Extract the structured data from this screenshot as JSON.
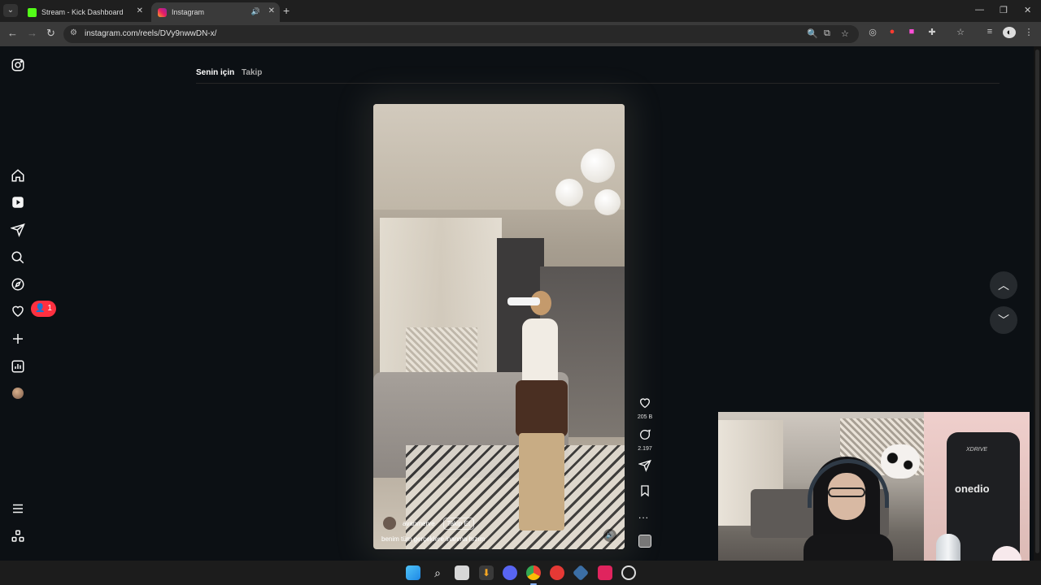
{
  "browser": {
    "tabs": [
      {
        "title": "Stream - Kick Dashboard"
      },
      {
        "title": "Instagram"
      }
    ],
    "url": "instagram.com/reels/DVy9nwwDN-x/"
  },
  "feed": {
    "tab_active": "Senin için",
    "tab_inactive": "Takip"
  },
  "notifications": {
    "badge_count": "1"
  },
  "reel": {
    "username": "avanmerve",
    "follow_label": "Takip Et",
    "caption": "benim tüm gerçeklere inanma hızım",
    "likes": "205 B",
    "comments": "2.197",
    "more": "..."
  },
  "webcam": {
    "chair_brand": "onedio",
    "chair_logo": "XDRIVE"
  },
  "colors": {
    "background": "#0c1014",
    "badge": "#ff3040",
    "kick_green": "#53fc18"
  }
}
